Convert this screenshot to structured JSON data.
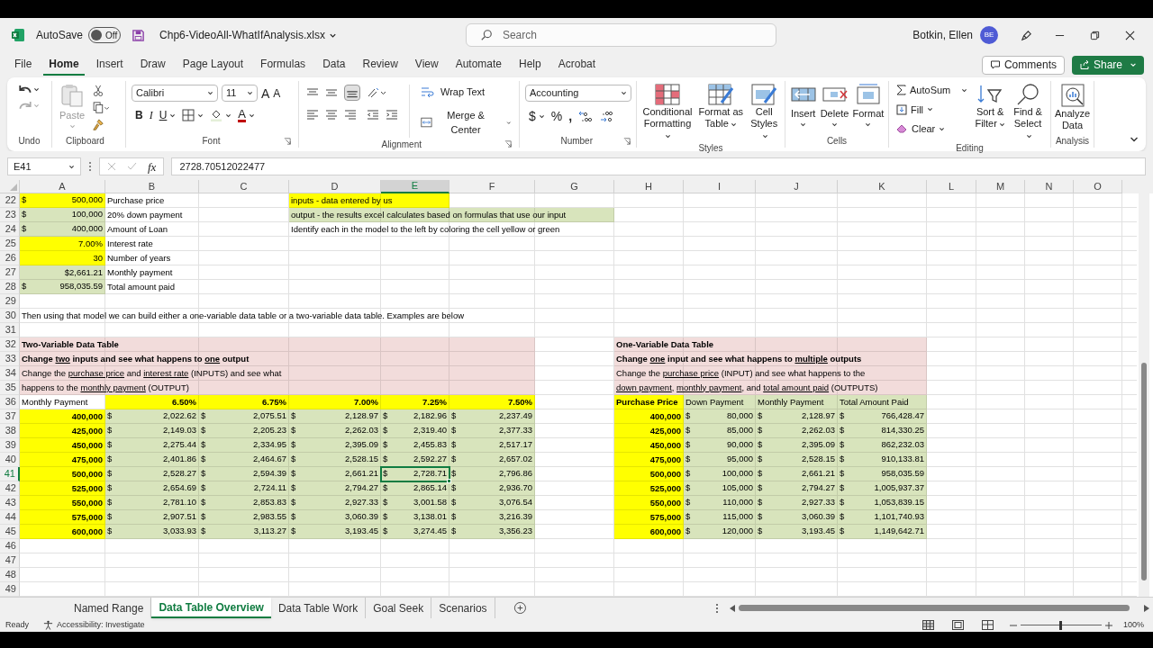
{
  "title_bar": {
    "autosave": "AutoSave",
    "autosave_state": "Off",
    "autosave_on": false,
    "filename": "Chp6-VideoAll-WhatIfAnalysis.xlsx",
    "search_placeholder": "Search",
    "user": "Botkin, Ellen",
    "avatar": "BE"
  },
  "menu_tabs": [
    {
      "label": "File",
      "selected": false
    },
    {
      "label": "Home",
      "selected": true
    },
    {
      "label": "Insert",
      "selected": false
    },
    {
      "label": "Draw",
      "selected": false
    },
    {
      "label": "Page Layout",
      "selected": false
    },
    {
      "label": "Formulas",
      "selected": false
    },
    {
      "label": "Data",
      "selected": false
    },
    {
      "label": "Review",
      "selected": false
    },
    {
      "label": "View",
      "selected": false
    },
    {
      "label": "Automate",
      "selected": false
    },
    {
      "label": "Help",
      "selected": false
    },
    {
      "label": "Acrobat",
      "selected": false
    }
  ],
  "comments_button": "Comments",
  "share_button": "Share",
  "ribbon": {
    "undo": {
      "label": "Undo"
    },
    "clipboard": {
      "label": "Clipboard",
      "paste": "Paste"
    },
    "font": {
      "label": "Font",
      "name": "Calibri",
      "size": "11",
      "grow": "A",
      "shrink": "A",
      "bold": "B",
      "italic": "I",
      "underline": "U",
      "letter_button": "A"
    },
    "alignment": {
      "label": "Alignment",
      "wrap": "Wrap Text",
      "merge": "Merge & Center"
    },
    "number": {
      "label": "Number",
      "format": "Accounting",
      "currency": "$",
      "percent": "%",
      "comma": ","
    },
    "styles": {
      "label": "Styles",
      "conditional": "Conditional Formatting",
      "table": "Format as Table",
      "cell": "Cell Styles"
    },
    "cells": {
      "label": "Cells",
      "insert": "Insert",
      "delete": "Delete",
      "format": "Format"
    },
    "editing": {
      "label": "Editing",
      "autosum": "AutoSum",
      "fill": "Fill",
      "clear": "Clear",
      "sort": "Sort & Filter",
      "find": "Find & Select"
    },
    "analysis": {
      "label": "Analysis",
      "analyze": "Analyze Data"
    }
  },
  "formula_bar": {
    "name_box": "E41",
    "fx": "fx",
    "formula": "2728.70512022477"
  },
  "columns": [
    {
      "letter": "A",
      "selected": false
    },
    {
      "letter": "B",
      "selected": false
    },
    {
      "letter": "C",
      "selected": false
    },
    {
      "letter": "D",
      "selected": false
    },
    {
      "letter": "E",
      "selected": true
    },
    {
      "letter": "F",
      "selected": false
    },
    {
      "letter": "G",
      "selected": false
    },
    {
      "letter": "H",
      "selected": false
    },
    {
      "letter": "I",
      "selected": false
    },
    {
      "letter": "J",
      "selected": false
    },
    {
      "letter": "K",
      "selected": false
    },
    {
      "letter": "L",
      "selected": false
    },
    {
      "letter": "M",
      "selected": false
    },
    {
      "letter": "N",
      "selected": false
    },
    {
      "letter": "O",
      "selected": false
    }
  ],
  "rows": [
    {
      "number": "22",
      "selected": false,
      "cells": [
        {
          "prefix": "$",
          "text": "500,000",
          "color": "#ffff00"
        },
        {
          "text": "Purchase price"
        },
        {},
        {
          "text": "inputs - data entered by us",
          "color": "#ffff00"
        },
        {
          "color": "#ffff00"
        }
      ]
    },
    {
      "number": "23",
      "selected": false,
      "cells": [
        {
          "prefix": "$",
          "text": "100,000",
          "color": "#d8e4bc"
        },
        {
          "text": "20% down payment"
        },
        {},
        {
          "text": "output - the results excel calculates based on formulas that use our input",
          "color": "#d8e4bc"
        },
        {
          "color": "#d8e4bc"
        },
        {
          "color": "#d8e4bc"
        },
        {
          "color": "#d8e4bc"
        }
      ]
    },
    {
      "number": "24",
      "selected": false,
      "cells": [
        {
          "prefix": "$",
          "text": "400,000",
          "color": "#d8e4bc"
        },
        {
          "text": "Amount of Loan"
        },
        {},
        {
          "text": "Identify each in the model to the left by coloring the cell yellow or green"
        }
      ]
    },
    {
      "number": "25",
      "selected": false,
      "cells": [
        {
          "text": "7.00%",
          "numeric": true,
          "color": "#ffff00"
        },
        {
          "text": "Interest rate"
        }
      ]
    },
    {
      "number": "26",
      "selected": false,
      "cells": [
        {
          "text": "30",
          "numeric": true,
          "color": "#ffff00"
        },
        {
          "text": "Number of years"
        }
      ]
    },
    {
      "number": "27",
      "selected": false,
      "cells": [
        {
          "text": "$2,661.21",
          "numeric": true,
          "color": "#d8e4bc"
        },
        {
          "text": "Monthly payment"
        }
      ]
    },
    {
      "number": "28",
      "selected": false,
      "cells": [
        {
          "prefix": "$",
          "text": "958,035.59",
          "color": "#d8e4bc"
        },
        {
          "text": "Total amount paid"
        }
      ]
    },
    {
      "number": "29",
      "selected": false
    },
    {
      "number": "30",
      "selected": false,
      "cells": [
        {
          "text": "Then using that model we can build either a one-variable data table or a two-variable data table.  Examples are below"
        }
      ]
    },
    {
      "number": "31",
      "selected": false
    },
    {
      "number": "32",
      "selected": false,
      "cells": [
        {
          "text": "Two-Variable Data Table",
          "bold": true,
          "color": "#f2dcdb"
        },
        {
          "color": "#f2dcdb"
        },
        {
          "color": "#f2dcdb"
        },
        {
          "color": "#f2dcdb"
        },
        {
          "color": "#f2dcdb"
        },
        {
          "color": "#f2dcdb"
        },
        {},
        {
          "text": "One-Variable Data Table",
          "bold": true,
          "color": "#f2dcdb"
        },
        {
          "color": "#f2dcdb"
        },
        {
          "color": "#f2dcdb"
        },
        {
          "color": "#f2dcdb"
        }
      ]
    },
    {
      "number": "33",
      "selected": false,
      "cells": [
        {
          "bold": true,
          "color": "#f2dcdb",
          "segments": [
            {
              "text": "Change ",
              "underline": false
            },
            {
              "text": "two",
              "underline": true
            },
            {
              "text": " inputs and see what happens to ",
              "underline": false
            },
            {
              "text": "one",
              "underline": true
            },
            {
              "text": " output",
              "underline": false
            }
          ]
        },
        {
          "color": "#f2dcdb"
        },
        {
          "color": "#f2dcdb"
        },
        {
          "color": "#f2dcdb"
        },
        {
          "color": "#f2dcdb"
        },
        {
          "color": "#f2dcdb"
        },
        {},
        {
          "bold": true,
          "color": "#f2dcdb",
          "segments": [
            {
              "text": "Change ",
              "underline": false
            },
            {
              "text": "one",
              "underline": true
            },
            {
              "text": " input and see what happens to ",
              "underline": false
            },
            {
              "text": "multiple",
              "underline": true
            },
            {
              "text": " outputs",
              "underline": false
            }
          ]
        },
        {
          "color": "#f2dcdb"
        },
        {
          "color": "#f2dcdb"
        },
        {
          "color": "#f2dcdb"
        }
      ]
    },
    {
      "number": "34",
      "selected": false,
      "cells": [
        {
          "color": "#f2dcdb",
          "segments": [
            {
              "text": "Change the ",
              "underline": false
            },
            {
              "text": "purchase price",
              "underline": true
            },
            {
              "text": " and ",
              "underline": false
            },
            {
              "text": "interest rate",
              "underline": true
            },
            {
              "text": " (INPUTS) and see what",
              "underline": false
            }
          ]
        },
        {
          "color": "#f2dcdb"
        },
        {
          "color": "#f2dcdb"
        },
        {
          "color": "#f2dcdb"
        },
        {
          "color": "#f2dcdb"
        },
        {
          "color": "#f2dcdb"
        },
        {},
        {
          "color": "#f2dcdb",
          "segments": [
            {
              "text": "Change the ",
              "underline": false
            },
            {
              "text": "purchase price",
              "underline": true
            },
            {
              "text": " (INPUT) and see what happens to the",
              "underline": false
            }
          ]
        },
        {
          "color": "#f2dcdb"
        },
        {
          "color": "#f2dcdb"
        },
        {
          "color": "#f2dcdb"
        }
      ]
    },
    {
      "number": "35",
      "selected": false,
      "cells": [
        {
          "color": "#f2dcdb",
          "segments": [
            {
              "text": "happens to the ",
              "underline": false
            },
            {
              "text": "monthly payment",
              "underline": true
            },
            {
              "text": " (OUTPUT)",
              "underline": false
            }
          ]
        },
        {
          "color": "#f2dcdb"
        },
        {
          "color": "#f2dcdb"
        },
        {
          "color": "#f2dcdb"
        },
        {
          "color": "#f2dcdb"
        },
        {
          "color": "#f2dcdb"
        },
        {},
        {
          "color": "#f2dcdb",
          "segments": [
            {
              "text": "down payment",
              "underline": true
            },
            {
              "text": ", ",
              "underline": false
            },
            {
              "text": "monthly payment",
              "underline": true
            },
            {
              "text": ", and ",
              "underline": false
            },
            {
              "text": "total amount paid",
              "underline": true
            },
            {
              "text": " (OUTPUTS)",
              "underline": false
            }
          ]
        },
        {
          "color": "#f2dcdb"
        },
        {
          "color": "#f2dcdb"
        },
        {
          "color": "#f2dcdb"
        }
      ]
    },
    {
      "number": "36",
      "selected": false,
      "cells": [
        {
          "text": "Monthly Payment"
        },
        {
          "text": "6.50%",
          "numeric": true,
          "bold": true,
          "color": "#ffff00"
        },
        {
          "text": "6.75%",
          "numeric": true,
          "bold": true,
          "color": "#ffff00"
        },
        {
          "text": "7.00%",
          "numeric": true,
          "bold": true,
          "color": "#ffff00"
        },
        {
          "text": "7.25%",
          "numeric": true,
          "bold": true,
          "color": "#ffff00"
        },
        {
          "text": "7.50%",
          "numeric": true,
          "bold": true,
          "color": "#ffff00"
        },
        {},
        {
          "text": "Purchase Price",
          "bold": true,
          "color": "#ffff00"
        },
        {
          "text": "Down Payment",
          "color": "#d8e4bc"
        },
        {
          "text": "Monthly Payment",
          "color": "#d8e4bc"
        },
        {
          "text": "Total Amount Paid",
          "color": "#d8e4bc"
        }
      ]
    },
    {
      "number": "37",
      "selected": false,
      "cells": [
        {
          "text": "400,000",
          "numeric": true,
          "bold": true,
          "color": "#ffff00"
        },
        {
          "prefix": "$",
          "text": "2,022.62",
          "color": "#d8e4bc"
        },
        {
          "prefix": "$",
          "text": "2,075.51",
          "color": "#d8e4bc"
        },
        {
          "prefix": "$",
          "text": "2,128.97",
          "color": "#d8e4bc"
        },
        {
          "prefix": "$",
          "text": "2,182.96",
          "color": "#d8e4bc"
        },
        {
          "prefix": "$",
          "text": "2,237.49",
          "color": "#d8e4bc"
        },
        {},
        {
          "text": "400,000",
          "numeric": true,
          "bold": true,
          "color": "#ffff00"
        },
        {
          "prefix": "$",
          "text": "80,000",
          "color": "#d8e4bc"
        },
        {
          "prefix": "$",
          "text": "2,128.97",
          "color": "#d8e4bc"
        },
        {
          "prefix": "$",
          "text": "766,428.47",
          "color": "#d8e4bc"
        }
      ]
    },
    {
      "number": "38",
      "selected": false,
      "cells": [
        {
          "text": "425,000",
          "numeric": true,
          "bold": true,
          "color": "#ffff00"
        },
        {
          "prefix": "$",
          "text": "2,149.03",
          "color": "#d8e4bc"
        },
        {
          "prefix": "$",
          "text": "2,205.23",
          "color": "#d8e4bc"
        },
        {
          "prefix": "$",
          "text": "2,262.03",
          "color": "#d8e4bc"
        },
        {
          "prefix": "$",
          "text": "2,319.40",
          "color": "#d8e4bc"
        },
        {
          "prefix": "$",
          "text": "2,377.33",
          "color": "#d8e4bc"
        },
        {},
        {
          "text": "425,000",
          "numeric": true,
          "bold": true,
          "color": "#ffff00"
        },
        {
          "prefix": "$",
          "text": "85,000",
          "color": "#d8e4bc"
        },
        {
          "prefix": "$",
          "text": "2,262.03",
          "color": "#d8e4bc"
        },
        {
          "prefix": "$",
          "text": "814,330.25",
          "color": "#d8e4bc"
        }
      ]
    },
    {
      "number": "39",
      "selected": false,
      "cells": [
        {
          "text": "450,000",
          "numeric": true,
          "bold": true,
          "color": "#ffff00"
        },
        {
          "prefix": "$",
          "text": "2,275.44",
          "color": "#d8e4bc"
        },
        {
          "prefix": "$",
          "text": "2,334.95",
          "color": "#d8e4bc"
        },
        {
          "prefix": "$",
          "text": "2,395.09",
          "color": "#d8e4bc"
        },
        {
          "prefix": "$",
          "text": "2,455.83",
          "color": "#d8e4bc"
        },
        {
          "prefix": "$",
          "text": "2,517.17",
          "color": "#d8e4bc"
        },
        {},
        {
          "text": "450,000",
          "numeric": true,
          "bold": true,
          "color": "#ffff00"
        },
        {
          "prefix": "$",
          "text": "90,000",
          "color": "#d8e4bc"
        },
        {
          "prefix": "$",
          "text": "2,395.09",
          "color": "#d8e4bc"
        },
        {
          "prefix": "$",
          "text": "862,232.03",
          "color": "#d8e4bc"
        }
      ]
    },
    {
      "number": "40",
      "selected": false,
      "cells": [
        {
          "text": "475,000",
          "numeric": true,
          "bold": true,
          "color": "#ffff00"
        },
        {
          "prefix": "$",
          "text": "2,401.86",
          "color": "#d8e4bc"
        },
        {
          "prefix": "$",
          "text": "2,464.67",
          "color": "#d8e4bc"
        },
        {
          "prefix": "$",
          "text": "2,528.15",
          "color": "#d8e4bc"
        },
        {
          "prefix": "$",
          "text": "2,592.27",
          "color": "#d8e4bc"
        },
        {
          "prefix": "$",
          "text": "2,657.02",
          "color": "#d8e4bc"
        },
        {},
        {
          "text": "475,000",
          "numeric": true,
          "bold": true,
          "color": "#ffff00"
        },
        {
          "prefix": "$",
          "text": "95,000",
          "color": "#d8e4bc"
        },
        {
          "prefix": "$",
          "text": "2,528.15",
          "color": "#d8e4bc"
        },
        {
          "prefix": "$",
          "text": "910,133.81",
          "color": "#d8e4bc"
        }
      ]
    },
    {
      "number": "41",
      "selected": true,
      "cells": [
        {
          "text": "500,000",
          "numeric": true,
          "bold": true,
          "color": "#ffff00"
        },
        {
          "prefix": "$",
          "text": "2,528.27",
          "color": "#d8e4bc"
        },
        {
          "prefix": "$",
          "text": "2,594.39",
          "color": "#d8e4bc"
        },
        {
          "prefix": "$",
          "text": "2,661.21",
          "color": "#d8e4bc"
        },
        {
          "prefix": "$",
          "text": "2,728.71",
          "color": "#d8e4bc"
        },
        {
          "prefix": "$",
          "text": "2,796.86",
          "color": "#d8e4bc"
        },
        {},
        {
          "text": "500,000",
          "numeric": true,
          "bold": true,
          "color": "#ffff00"
        },
        {
          "prefix": "$",
          "text": "100,000",
          "color": "#d8e4bc"
        },
        {
          "prefix": "$",
          "text": "2,661.21",
          "color": "#d8e4bc"
        },
        {
          "prefix": "$",
          "text": "958,035.59",
          "color": "#d8e4bc"
        }
      ]
    },
    {
      "number": "42",
      "selected": false,
      "cells": [
        {
          "text": "525,000",
          "numeric": true,
          "bold": true,
          "color": "#ffff00"
        },
        {
          "prefix": "$",
          "text": "2,654.69",
          "color": "#d8e4bc"
        },
        {
          "prefix": "$",
          "text": "2,724.11",
          "color": "#d8e4bc"
        },
        {
          "prefix": "$",
          "text": "2,794.27",
          "color": "#d8e4bc"
        },
        {
          "prefix": "$",
          "text": "2,865.14",
          "color": "#d8e4bc"
        },
        {
          "prefix": "$",
          "text": "2,936.70",
          "color": "#d8e4bc"
        },
        {},
        {
          "text": "525,000",
          "numeric": true,
          "bold": true,
          "color": "#ffff00"
        },
        {
          "prefix": "$",
          "text": "105,000",
          "color": "#d8e4bc"
        },
        {
          "prefix": "$",
          "text": "2,794.27",
          "color": "#d8e4bc"
        },
        {
          "prefix": "$",
          "text": "1,005,937.37",
          "color": "#d8e4bc"
        }
      ]
    },
    {
      "number": "43",
      "selected": false,
      "cells": [
        {
          "text": "550,000",
          "numeric": true,
          "bold": true,
          "color": "#ffff00"
        },
        {
          "prefix": "$",
          "text": "2,781.10",
          "color": "#d8e4bc"
        },
        {
          "prefix": "$",
          "text": "2,853.83",
          "color": "#d8e4bc"
        },
        {
          "prefix": "$",
          "text": "2,927.33",
          "color": "#d8e4bc"
        },
        {
          "prefix": "$",
          "text": "3,001.58",
          "color": "#d8e4bc"
        },
        {
          "prefix": "$",
          "text": "3,076.54",
          "color": "#d8e4bc"
        },
        {},
        {
          "text": "550,000",
          "numeric": true,
          "bold": true,
          "color": "#ffff00"
        },
        {
          "prefix": "$",
          "text": "110,000",
          "color": "#d8e4bc"
        },
        {
          "prefix": "$",
          "text": "2,927.33",
          "color": "#d8e4bc"
        },
        {
          "prefix": "$",
          "text": "1,053,839.15",
          "color": "#d8e4bc"
        }
      ]
    },
    {
      "number": "44",
      "selected": false,
      "cells": [
        {
          "text": "575,000",
          "numeric": true,
          "bold": true,
          "color": "#ffff00"
        },
        {
          "prefix": "$",
          "text": "2,907.51",
          "color": "#d8e4bc"
        },
        {
          "prefix": "$",
          "text": "2,983.55",
          "color": "#d8e4bc"
        },
        {
          "prefix": "$",
          "text": "3,060.39",
          "color": "#d8e4bc"
        },
        {
          "prefix": "$",
          "text": "3,138.01",
          "color": "#d8e4bc"
        },
        {
          "prefix": "$",
          "text": "3,216.39",
          "color": "#d8e4bc"
        },
        {},
        {
          "text": "575,000",
          "numeric": true,
          "bold": true,
          "color": "#ffff00"
        },
        {
          "prefix": "$",
          "text": "115,000",
          "color": "#d8e4bc"
        },
        {
          "prefix": "$",
          "text": "3,060.39",
          "color": "#d8e4bc"
        },
        {
          "prefix": "$",
          "text": "1,101,740.93",
          "color": "#d8e4bc"
        }
      ]
    },
    {
      "number": "45",
      "selected": false,
      "cells": [
        {
          "text": "600,000",
          "numeric": true,
          "bold": true,
          "color": "#ffff00"
        },
        {
          "prefix": "$",
          "text": "3,033.93",
          "color": "#d8e4bc"
        },
        {
          "prefix": "$",
          "text": "3,113.27",
          "color": "#d8e4bc"
        },
        {
          "prefix": "$",
          "text": "3,193.45",
          "color": "#d8e4bc"
        },
        {
          "prefix": "$",
          "text": "3,274.45",
          "color": "#d8e4bc"
        },
        {
          "prefix": "$",
          "text": "3,356.23",
          "color": "#d8e4bc"
        },
        {},
        {
          "text": "600,000",
          "numeric": true,
          "bold": true,
          "color": "#ffff00"
        },
        {
          "prefix": "$",
          "text": "120,000",
          "color": "#d8e4bc"
        },
        {
          "prefix": "$",
          "text": "3,193.45",
          "color": "#d8e4bc"
        },
        {
          "prefix": "$",
          "text": "1,149,642.71",
          "color": "#d8e4bc"
        }
      ]
    },
    {
      "number": "46",
      "selected": false
    },
    {
      "number": "47",
      "selected": false
    },
    {
      "number": "48",
      "selected": false
    },
    {
      "number": "49",
      "selected": false
    }
  ],
  "sheet_tabs": [
    {
      "label": "Named Range",
      "selected": false
    },
    {
      "label": "Data Table Overview",
      "selected": true
    },
    {
      "label": "Data Table Work",
      "selected": false
    },
    {
      "label": "Goal Seek",
      "selected": false
    },
    {
      "label": "Scenarios",
      "selected": false
    }
  ],
  "status_bar": {
    "ready": "Ready",
    "accessibility": "Accessibility: Investigate",
    "zoom_slider": {
      "level": 0.5
    },
    "zoom": "100%"
  }
}
